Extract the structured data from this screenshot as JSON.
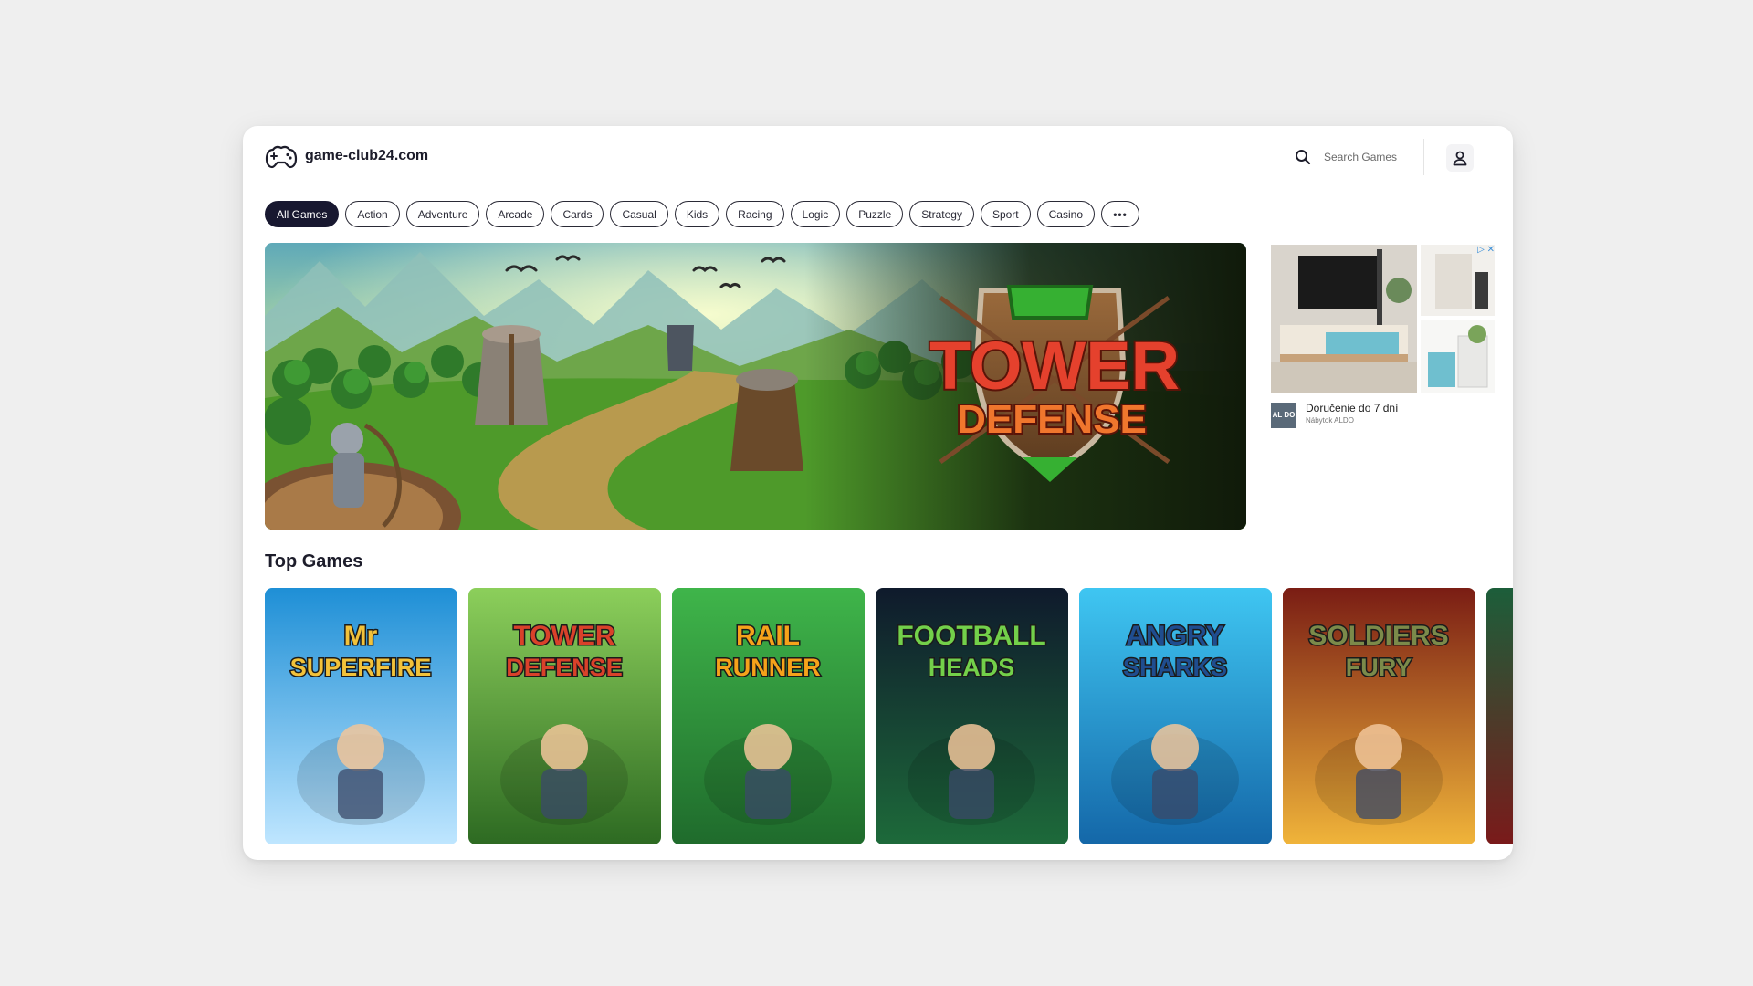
{
  "site": {
    "name": "game-club24.com"
  },
  "search": {
    "placeholder": "Search Games"
  },
  "categories": [
    {
      "label": "All Games",
      "active": true
    },
    {
      "label": "Action"
    },
    {
      "label": "Adventure"
    },
    {
      "label": "Arcade"
    },
    {
      "label": "Cards"
    },
    {
      "label": "Casual"
    },
    {
      "label": "Kids"
    },
    {
      "label": "Racing"
    },
    {
      "label": "Logic"
    },
    {
      "label": "Puzzle"
    },
    {
      "label": "Strategy"
    },
    {
      "label": "Sport"
    },
    {
      "label": "Casino"
    },
    {
      "label": "•••"
    }
  ],
  "hero": {
    "title_line1": "TOWER",
    "title_line2": "DEFENSE"
  },
  "ad": {
    "badge": "▷ ✕",
    "logo_text": "AL DO",
    "title": "Doručenie do 7 dní",
    "subtitle": "Nábytok ALDO"
  },
  "top_games": {
    "title": "Top Games",
    "items": [
      {
        "line1": "Mr",
        "line2": "SUPERFIRE",
        "bg_top": "#1e8fd6",
        "bg_bottom": "#bfe6ff",
        "text_color": "#f2c23a"
      },
      {
        "line1": "TOWER",
        "line2": "DEFENSE",
        "bg_top": "#8ccf5b",
        "bg_bottom": "#2d6a22",
        "text_color": "#d9412a"
      },
      {
        "line1": "RAIL",
        "line2": "RUNNER",
        "bg_top": "#3fb54a",
        "bg_bottom": "#1f6b2c",
        "text_color": "#f6a21a"
      },
      {
        "line1": "FOOTBALL",
        "line2": "HEADS",
        "bg_top": "#0f1a2c",
        "bg_bottom": "#1d6a3a",
        "text_color": "#73d04a"
      },
      {
        "line1": "ANGRY",
        "line2": "SHARKS",
        "bg_top": "#3fc6f2",
        "bg_bottom": "#1467a8",
        "text_color": "#1f4d8f"
      },
      {
        "line1": "SOLDIERS",
        "line2": "FURY",
        "bg_top": "#7a1d14",
        "bg_bottom": "#f0b43a",
        "text_color": "#7b8a4a"
      },
      {
        "line1": "",
        "line2": "",
        "bg_top": "#1c5e3a",
        "bg_bottom": "#7a1a1a",
        "text_color": "#ffffff"
      }
    ]
  }
}
